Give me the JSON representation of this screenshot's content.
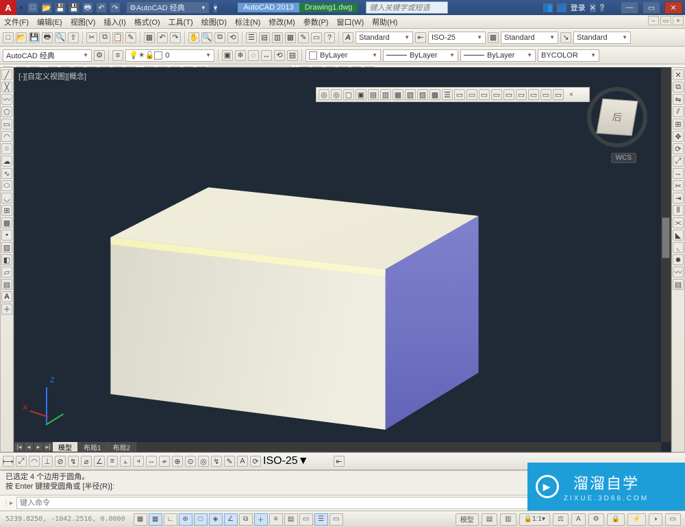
{
  "title": {
    "workspace_value": "AutoCAD 经典",
    "app": "AutoCAD 2013",
    "file": "Drawing1.dwg",
    "search_placeholder": "键入关键字或短语",
    "login": "登录"
  },
  "menubar": [
    "文件(F)",
    "编辑(E)",
    "视图(V)",
    "插入(I)",
    "格式(O)",
    "工具(T)",
    "绘图(D)",
    "标注(N)",
    "修改(M)",
    "参数(P)",
    "窗口(W)",
    "帮助(H)"
  ],
  "styles_row": {
    "text_style": "Standard",
    "dim_style": "ISO-25",
    "table_style": "Standard",
    "ml_style": "Standard"
  },
  "layers_row": {
    "workspace": "AutoCAD 经典",
    "layer": "0",
    "bylayer_color": "ByLayer",
    "bylayer_lt": "ByLayer",
    "bylayer_lw": "ByLayer",
    "plot": "BYCOLOR"
  },
  "viewport_label": "[-][自定义视图][概念]",
  "viewcube_face": "后",
  "wcs_label": "WCS",
  "layout_tabs": [
    "模型",
    "布局1",
    "布局2"
  ],
  "dim_combo": "ISO-25",
  "cmd_history": [
    "已选定 4 个边用于圆角。",
    "按 Enter 键接受圆角或 [半径(R)]:"
  ],
  "cmd_placeholder": "键入命令",
  "status": {
    "coord": "5239.8250, -1042.2516, 0.0000",
    "model_btn": "模型",
    "scale": "1:1"
  },
  "watermark": {
    "big": "溜溜自学",
    "small": "ZIXUE.3D66.COM"
  },
  "ucs_labels": {
    "x": "X",
    "z": "Z"
  }
}
